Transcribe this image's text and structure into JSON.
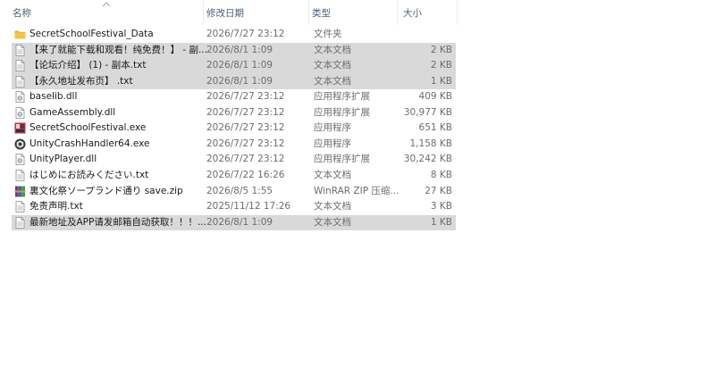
{
  "columns": {
    "name": "名称",
    "date": "修改日期",
    "type": "类型",
    "size": "大小"
  },
  "rows": [
    {
      "name": "SecretSchoolFestival_Data",
      "date": "2026/7/27 23:12",
      "type": "文件夹",
      "size": "",
      "icon": "folder-icon",
      "selected": false
    },
    {
      "name": "【来了就能下载和观看！纯免费！】 - 副...",
      "date": "2026/8/1 1:09",
      "type": "文本文档",
      "size": "2 KB",
      "icon": "text-file-icon",
      "selected": true
    },
    {
      "name": "【论坛介绍】 (1) - 副本.txt",
      "date": "2026/8/1 1:09",
      "type": "文本文档",
      "size": "2 KB",
      "icon": "text-file-icon",
      "selected": true
    },
    {
      "name": "【永久地址发布页】 .txt",
      "date": "2026/8/1 1:09",
      "type": "文本文档",
      "size": "1 KB",
      "icon": "text-file-icon",
      "selected": true
    },
    {
      "name": "baselib.dll",
      "date": "2026/7/27 23:12",
      "type": "应用程序扩展",
      "size": "409 KB",
      "icon": "dll-file-icon",
      "selected": false
    },
    {
      "name": "GameAssembly.dll",
      "date": "2026/7/27 23:12",
      "type": "应用程序扩展",
      "size": "30,977 KB",
      "icon": "dll-file-icon",
      "selected": false
    },
    {
      "name": "SecretSchoolFestival.exe",
      "date": "2026/7/27 23:12",
      "type": "应用程序",
      "size": "651 KB",
      "icon": "game-exe-icon",
      "selected": false
    },
    {
      "name": "UnityCrashHandler64.exe",
      "date": "2026/7/27 23:12",
      "type": "应用程序",
      "size": "1,158 KB",
      "icon": "unity-icon",
      "selected": false
    },
    {
      "name": "UnityPlayer.dll",
      "date": "2026/7/27 23:12",
      "type": "应用程序扩展",
      "size": "30,242 KB",
      "icon": "dll-file-icon",
      "selected": false
    },
    {
      "name": "はじめにお読みください.txt",
      "date": "2026/7/22 16:26",
      "type": "文本文档",
      "size": "8 KB",
      "icon": "text-file-icon",
      "selected": false
    },
    {
      "name": "裏文化祭ソープランド通り save.zip",
      "date": "2026/8/5 1:55",
      "type": "WinRAR ZIP 压缩...",
      "size": "27 KB",
      "icon": "winrar-zip-icon",
      "selected": false
    },
    {
      "name": "免责声明.txt",
      "date": "2025/11/12 17:26",
      "type": "文本文档",
      "size": "3 KB",
      "icon": "text-file-icon",
      "selected": false
    },
    {
      "name": "最新地址及APP请发邮箱自动获取！！！...",
      "date": "2026/8/1 1:09",
      "type": "文本文档",
      "size": "1 KB",
      "icon": "text-file-icon",
      "selected": true
    }
  ],
  "colors": {
    "header_text": "#4a5f7a",
    "selected_row": "#d9d9d9",
    "meta_text": "#6d6d6d",
    "folder": "#f5c542"
  }
}
